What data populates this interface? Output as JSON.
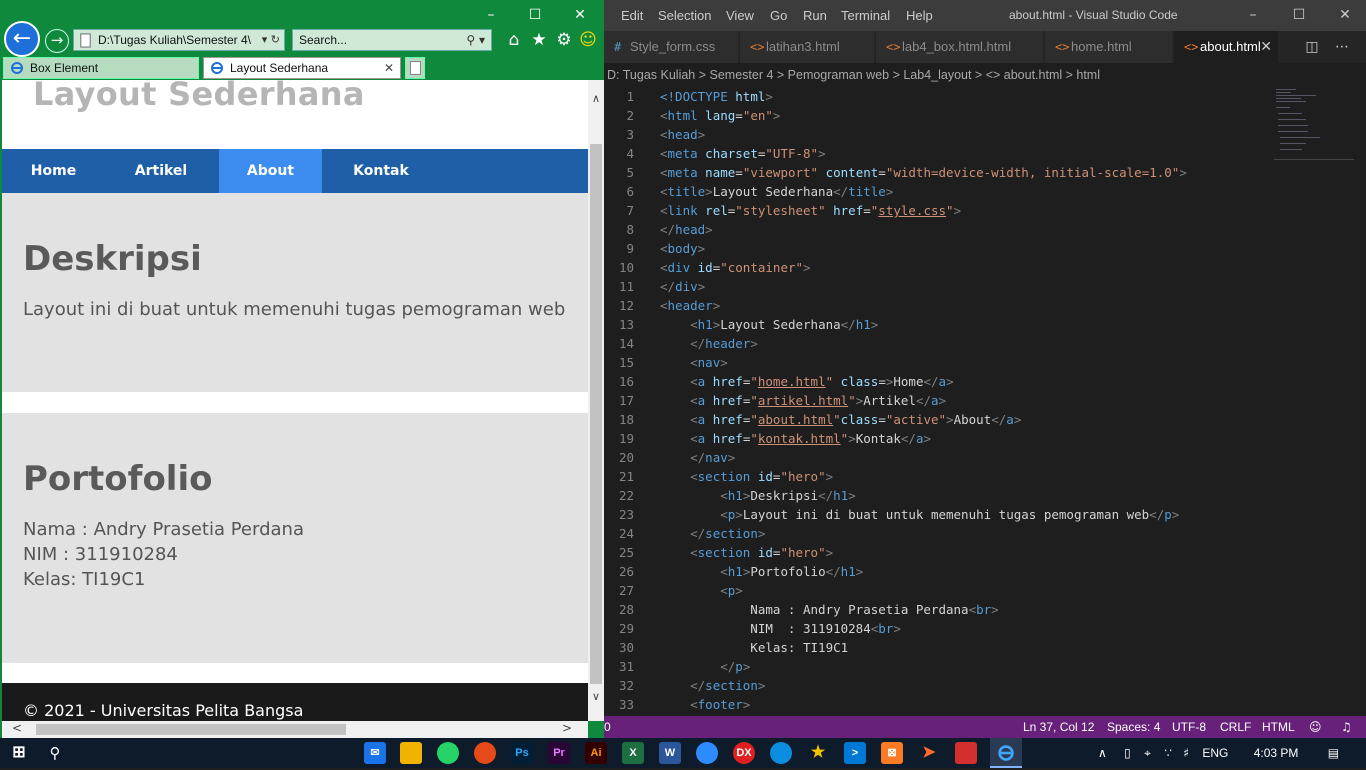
{
  "ie": {
    "address": "D:\\Tugas Kuliah\\Semester 4\\",
    "search_placeholder": "Search...",
    "tabs": [
      {
        "label": "Box Element"
      },
      {
        "label": "Layout Sederhana"
      }
    ]
  },
  "page": {
    "header_title": "Layout Sederhana",
    "nav": [
      "Home",
      "Artikel",
      "About",
      "Kontak"
    ],
    "active_nav": "About",
    "sections": [
      {
        "title": "Deskripsi",
        "lines": [
          "Layout ini di buat untuk memenuhi tugas pemograman web"
        ]
      },
      {
        "title": "Portofolio",
        "lines": [
          "Nama : Andry Prasetia Perdana",
          "NIM : 311910284",
          "Kelas: TI19C1"
        ]
      }
    ],
    "footer": "© 2021 - Universitas Pelita Bangsa"
  },
  "vscode": {
    "menu": [
      "Edit",
      "Selection",
      "View",
      "Go",
      "Run",
      "Terminal",
      "Help"
    ],
    "window_title": "about.html - Visual Studio Code",
    "tabs": [
      {
        "label": "Style_form.css",
        "icon": "#"
      },
      {
        "label": "latihan3.html",
        "icon": "<>"
      },
      {
        "label": "lab4_box.html.html",
        "icon": "<>"
      },
      {
        "label": "home.html",
        "icon": "<>"
      },
      {
        "label": "about.html",
        "icon": "<>"
      }
    ],
    "breadcrumb": "D:  Tugas Kuliah  >  Semester 4  >  Pemograman web  >  Lab4_layout  >  <> about.html  >  html",
    "code_lines": [
      {
        "n": "1",
        "html": "<span class='t'>&lt;!DOCTYPE</span> <span class='a'>html</span><span class='p'>&gt;</span>"
      },
      {
        "n": "2",
        "html": "<span class='p'>&lt;</span><span class='t'>html</span> <span class='a'>lang</span>=<span class='s'>\"en\"</span><span class='p'>&gt;</span>"
      },
      {
        "n": "3",
        "html": "<span class='p'>&lt;</span><span class='t'>head</span><span class='p'>&gt;</span>"
      },
      {
        "n": "4",
        "html": "<span class='p'>&lt;</span><span class='t'>meta</span> <span class='a'>charset</span>=<span class='s'>\"UTF-8\"</span><span class='p'>&gt;</span>"
      },
      {
        "n": "5",
        "html": "<span class='p'>&lt;</span><span class='t'>meta</span> <span class='a'>name</span>=<span class='s'>\"viewport\"</span> <span class='a'>content</span>=<span class='s'>\"width=device-width, initial-scale=1.0\"</span><span class='p'>&gt;</span>"
      },
      {
        "n": "6",
        "html": "<span class='p'>&lt;</span><span class='t'>title</span><span class='p'>&gt;</span>Layout Sederhana<span class='p'>&lt;/</span><span class='t'>title</span><span class='p'>&gt;</span>"
      },
      {
        "n": "7",
        "html": "<span class='p'>&lt;</span><span class='t'>link</span> <span class='a'>rel</span>=<span class='s'>\"stylesheet\"</span> <span class='a'>href</span>=<span class='s'>\"<span class='u'>style.css</span>\"</span><span class='p'>&gt;</span>"
      },
      {
        "n": "8",
        "html": "<span class='p'>&lt;/</span><span class='t'>head</span><span class='p'>&gt;</span>"
      },
      {
        "n": "9",
        "html": "<span class='p'>&lt;</span><span class='t'>body</span><span class='p'>&gt;</span>"
      },
      {
        "n": "10",
        "html": "<span class='p'>&lt;</span><span class='t'>div</span> <span class='a'>id</span>=<span class='s'>\"container\"</span><span class='p'>&gt;</span>"
      },
      {
        "n": "11",
        "html": "<span class='p'>&lt;/</span><span class='t'>div</span><span class='p'>&gt;</span>"
      },
      {
        "n": "12",
        "html": "<span class='p'>&lt;</span><span class='t'>header</span><span class='p'>&gt;</span>"
      },
      {
        "n": "13",
        "html": "    <span class='p'>&lt;</span><span class='t'>h1</span><span class='p'>&gt;</span>Layout Sederhana<span class='p'>&lt;/</span><span class='t'>h1</span><span class='p'>&gt;</span>"
      },
      {
        "n": "14",
        "html": "    <span class='p'>&lt;/</span><span class='t'>header</span><span class='p'>&gt;</span>"
      },
      {
        "n": "15",
        "html": "    <span class='p'>&lt;</span><span class='t'>nav</span><span class='p'>&gt;</span>"
      },
      {
        "n": "16",
        "html": "    <span class='p'>&lt;</span><span class='t'>a</span> <span class='a'>href</span>=<span class='s'>\"<span class='u'>home.html</span>\"</span> <span class='a'>class</span>=<span class='p'>&gt;</span>Home<span class='p'>&lt;/</span><span class='t'>a</span><span class='p'>&gt;</span>"
      },
      {
        "n": "17",
        "html": "    <span class='p'>&lt;</span><span class='t'>a</span> <span class='a'>href</span>=<span class='s'>\"<span class='u'>artikel.html</span>\"</span><span class='p'>&gt;</span>Artikel<span class='p'>&lt;/</span><span class='t'>a</span><span class='p'>&gt;</span>"
      },
      {
        "n": "18",
        "html": "    <span class='p'>&lt;</span><span class='t'>a</span> <span class='a'>href</span>=<span class='s'>\"<span class='u'>about.html</span>\"</span><span class='a'>class</span>=<span class='s'>\"active\"</span><span class='p'>&gt;</span>About<span class='p'>&lt;/</span><span class='t'>a</span><span class='p'>&gt;</span>"
      },
      {
        "n": "19",
        "html": "    <span class='p'>&lt;</span><span class='t'>a</span> <span class='a'>href</span>=<span class='s'>\"<span class='u'>kontak.html</span>\"</span><span class='p'>&gt;</span>Kontak<span class='p'>&lt;/</span><span class='t'>a</span><span class='p'>&gt;</span>"
      },
      {
        "n": "20",
        "html": "    <span class='p'>&lt;/</span><span class='t'>nav</span><span class='p'>&gt;</span>"
      },
      {
        "n": "21",
        "html": "    <span class='p'>&lt;</span><span class='t'>section</span> <span class='a'>id</span>=<span class='s'>\"hero\"</span><span class='p'>&gt;</span>"
      },
      {
        "n": "22",
        "html": "        <span class='p'>&lt;</span><span class='t'>h1</span><span class='p'>&gt;</span>Deskripsi<span class='p'>&lt;/</span><span class='t'>h1</span><span class='p'>&gt;</span>"
      },
      {
        "n": "23",
        "html": "        <span class='p'>&lt;</span><span class='t'>p</span><span class='p'>&gt;</span>Layout ini di buat untuk memenuhi tugas pemograman web<span class='p'>&lt;/</span><span class='t'>p</span><span class='p'>&gt;</span>"
      },
      {
        "n": "24",
        "html": "    <span class='p'>&lt;/</span><span class='t'>section</span><span class='p'>&gt;</span>"
      },
      {
        "n": "25",
        "html": "    <span class='p'>&lt;</span><span class='t'>section</span> <span class='a'>id</span>=<span class='s'>\"hero\"</span><span class='p'>&gt;</span>"
      },
      {
        "n": "26",
        "html": "        <span class='p'>&lt;</span><span class='t'>h1</span><span class='p'>&gt;</span>Portofolio<span class='p'>&lt;/</span><span class='t'>h1</span><span class='p'>&gt;</span>"
      },
      {
        "n": "27",
        "html": "        <span class='p'>&lt;</span><span class='t'>p</span><span class='p'>&gt;</span>"
      },
      {
        "n": "28",
        "html": "            Nama : Andry Prasetia Perdana<span class='p'>&lt;</span><span class='t'>br</span><span class='p'>&gt;</span>"
      },
      {
        "n": "29",
        "html": "            NIM  : 311910284<span class='p'>&lt;</span><span class='t'>br</span><span class='p'>&gt;</span>"
      },
      {
        "n": "30",
        "html": "            Kelas: TI19C1"
      },
      {
        "n": "31",
        "html": "        <span class='p'>&lt;/</span><span class='t'>p</span><span class='p'>&gt;</span>"
      },
      {
        "n": "32",
        "html": "    <span class='p'>&lt;/</span><span class='t'>section</span><span class='p'>&gt;</span>"
      },
      {
        "n": "33",
        "html": "    <span class='p'>&lt;</span><span class='t'>footer</span><span class='p'>&gt;</span>"
      }
    ],
    "status": {
      "left": "0",
      "position": "Ln 37, Col 12",
      "spaces": "Spaces: 4",
      "encoding": "UTF-8",
      "eol": "CRLF",
      "language": "HTML"
    }
  },
  "taskbar": {
    "lang": "ENG",
    "time": "4:03 PM"
  }
}
